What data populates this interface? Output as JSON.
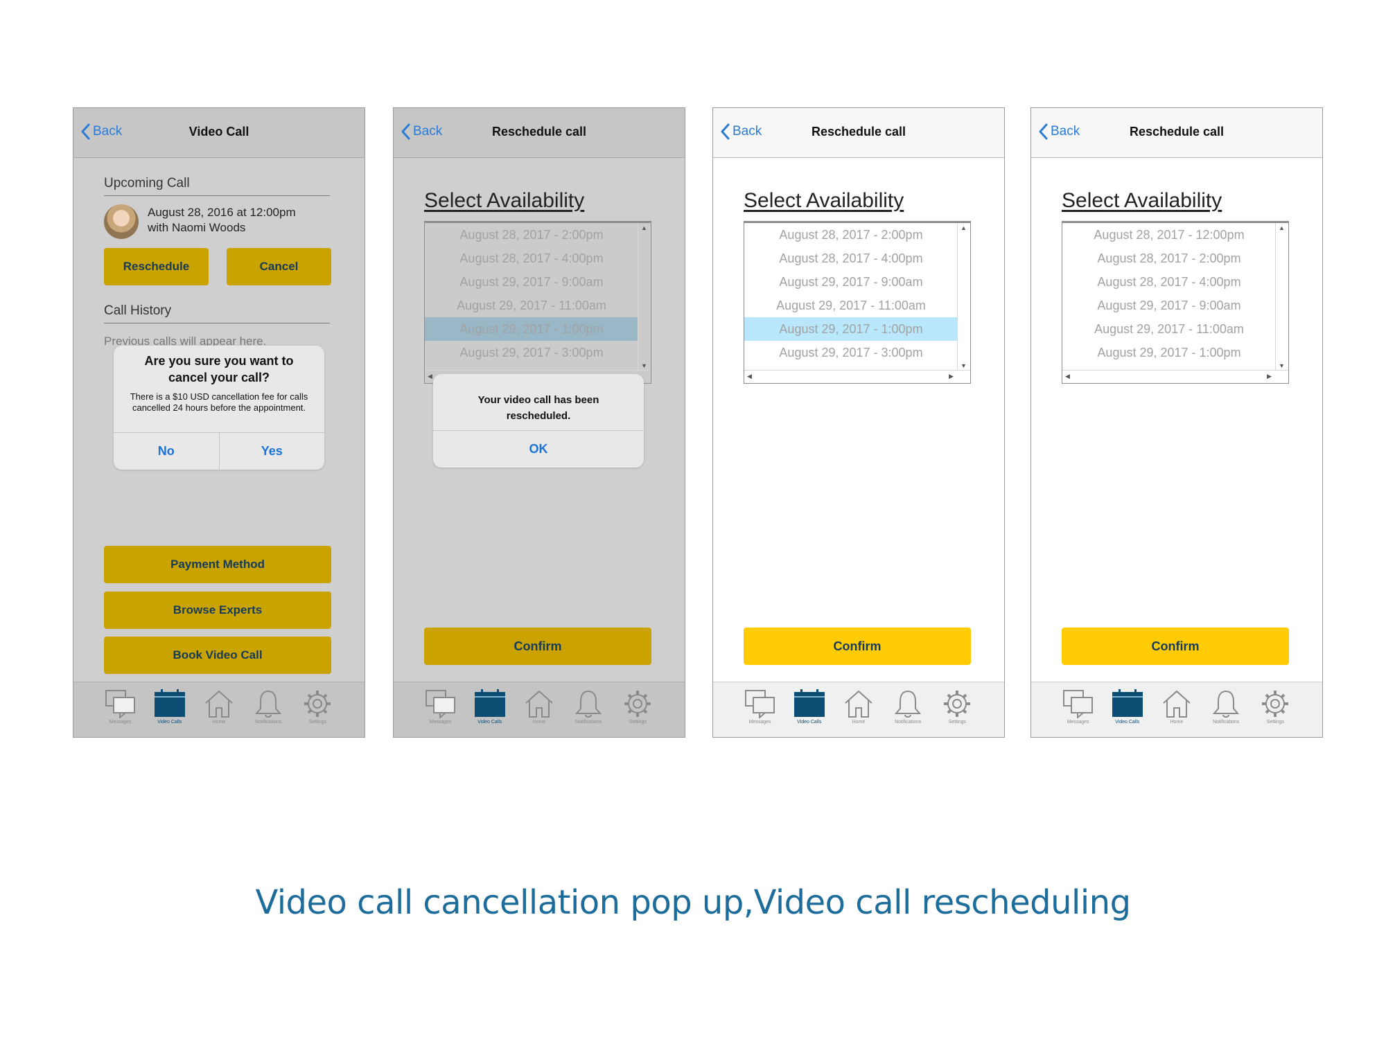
{
  "colors": {
    "mustard_button": "#c9a300",
    "confirm_yellow": "#ffcb05",
    "ios_blue": "#2a7bd6",
    "dim_overlay": "#cfcfcf",
    "selected_row": "#b9e7fb",
    "active_tab": "#0e4d73",
    "caption_blue": "#1c6c9c"
  },
  "screens": [
    {
      "nav": {
        "back": "Back",
        "title": "Video Call"
      },
      "upcoming": {
        "header": "Upcoming Call",
        "date": "August 28, 2016 at 12:00pm",
        "with": "with Naomi Woods",
        "reschedule": "Reschedule",
        "cancel": "Cancel"
      },
      "history": {
        "header": "Call History",
        "placeholder": "Previous calls will appear here."
      },
      "alert": {
        "title": "Are you sure you want to cancel your call?",
        "message": "There is a $10 USD cancellation fee for calls cancelled 24 hours before the appointment.",
        "no": "No",
        "yes": "Yes"
      },
      "buttons": {
        "payment": "Payment Method",
        "browse": "Browse Experts",
        "book": "Book Video Call"
      }
    },
    {
      "nav": {
        "back": "Back",
        "title": "Reschedule call"
      },
      "heading": "Select Availability",
      "slots": [
        "August 28, 2017 - 2:00pm",
        "August 28, 2017 - 4:00pm",
        "August 29, 2017 - 9:00am",
        "August 29, 2017 - 11:00am",
        "August 29, 2017 - 1:00pm",
        "August 29, 2017 - 3:00pm"
      ],
      "selected_index": 4,
      "alert": {
        "message": "Your video call has been rescheduled.",
        "ok": "OK"
      },
      "confirm": "Confirm"
    },
    {
      "nav": {
        "back": "Back",
        "title": "Reschedule call"
      },
      "heading": "Select Availability",
      "slots": [
        "August 28, 2017 - 2:00pm",
        "August 28, 2017 - 4:00pm",
        "August 29, 2017 - 9:00am",
        "August 29, 2017 - 11:00am",
        "August 29, 2017 - 1:00pm",
        "August 29, 2017 - 3:00pm"
      ],
      "selected_index": 4,
      "confirm": "Confirm"
    },
    {
      "nav": {
        "back": "Back",
        "title": "Reschedule call"
      },
      "heading": "Select Availability",
      "slots": [
        "August 28, 2017 - 12:00pm",
        "August 28, 2017 - 2:00pm",
        "August 28, 2017 - 4:00pm",
        "August 29, 2017 - 9:00am",
        "August 29, 2017 - 11:00am",
        "August 29, 2017 - 1:00pm"
      ],
      "selected_index": -1,
      "confirm": "Confirm"
    }
  ],
  "tabbar": {
    "items": [
      {
        "label": "Messages",
        "icon": "messages-icon"
      },
      {
        "label": "Video Calls",
        "icon": "calendar-icon"
      },
      {
        "label": "Home",
        "icon": "home-icon"
      },
      {
        "label": "Notifications",
        "icon": "bell-icon"
      },
      {
        "label": "Settings",
        "icon": "gear-icon"
      }
    ],
    "active_index": 1
  },
  "caption": "Video call cancellation pop up,Video call rescheduling"
}
